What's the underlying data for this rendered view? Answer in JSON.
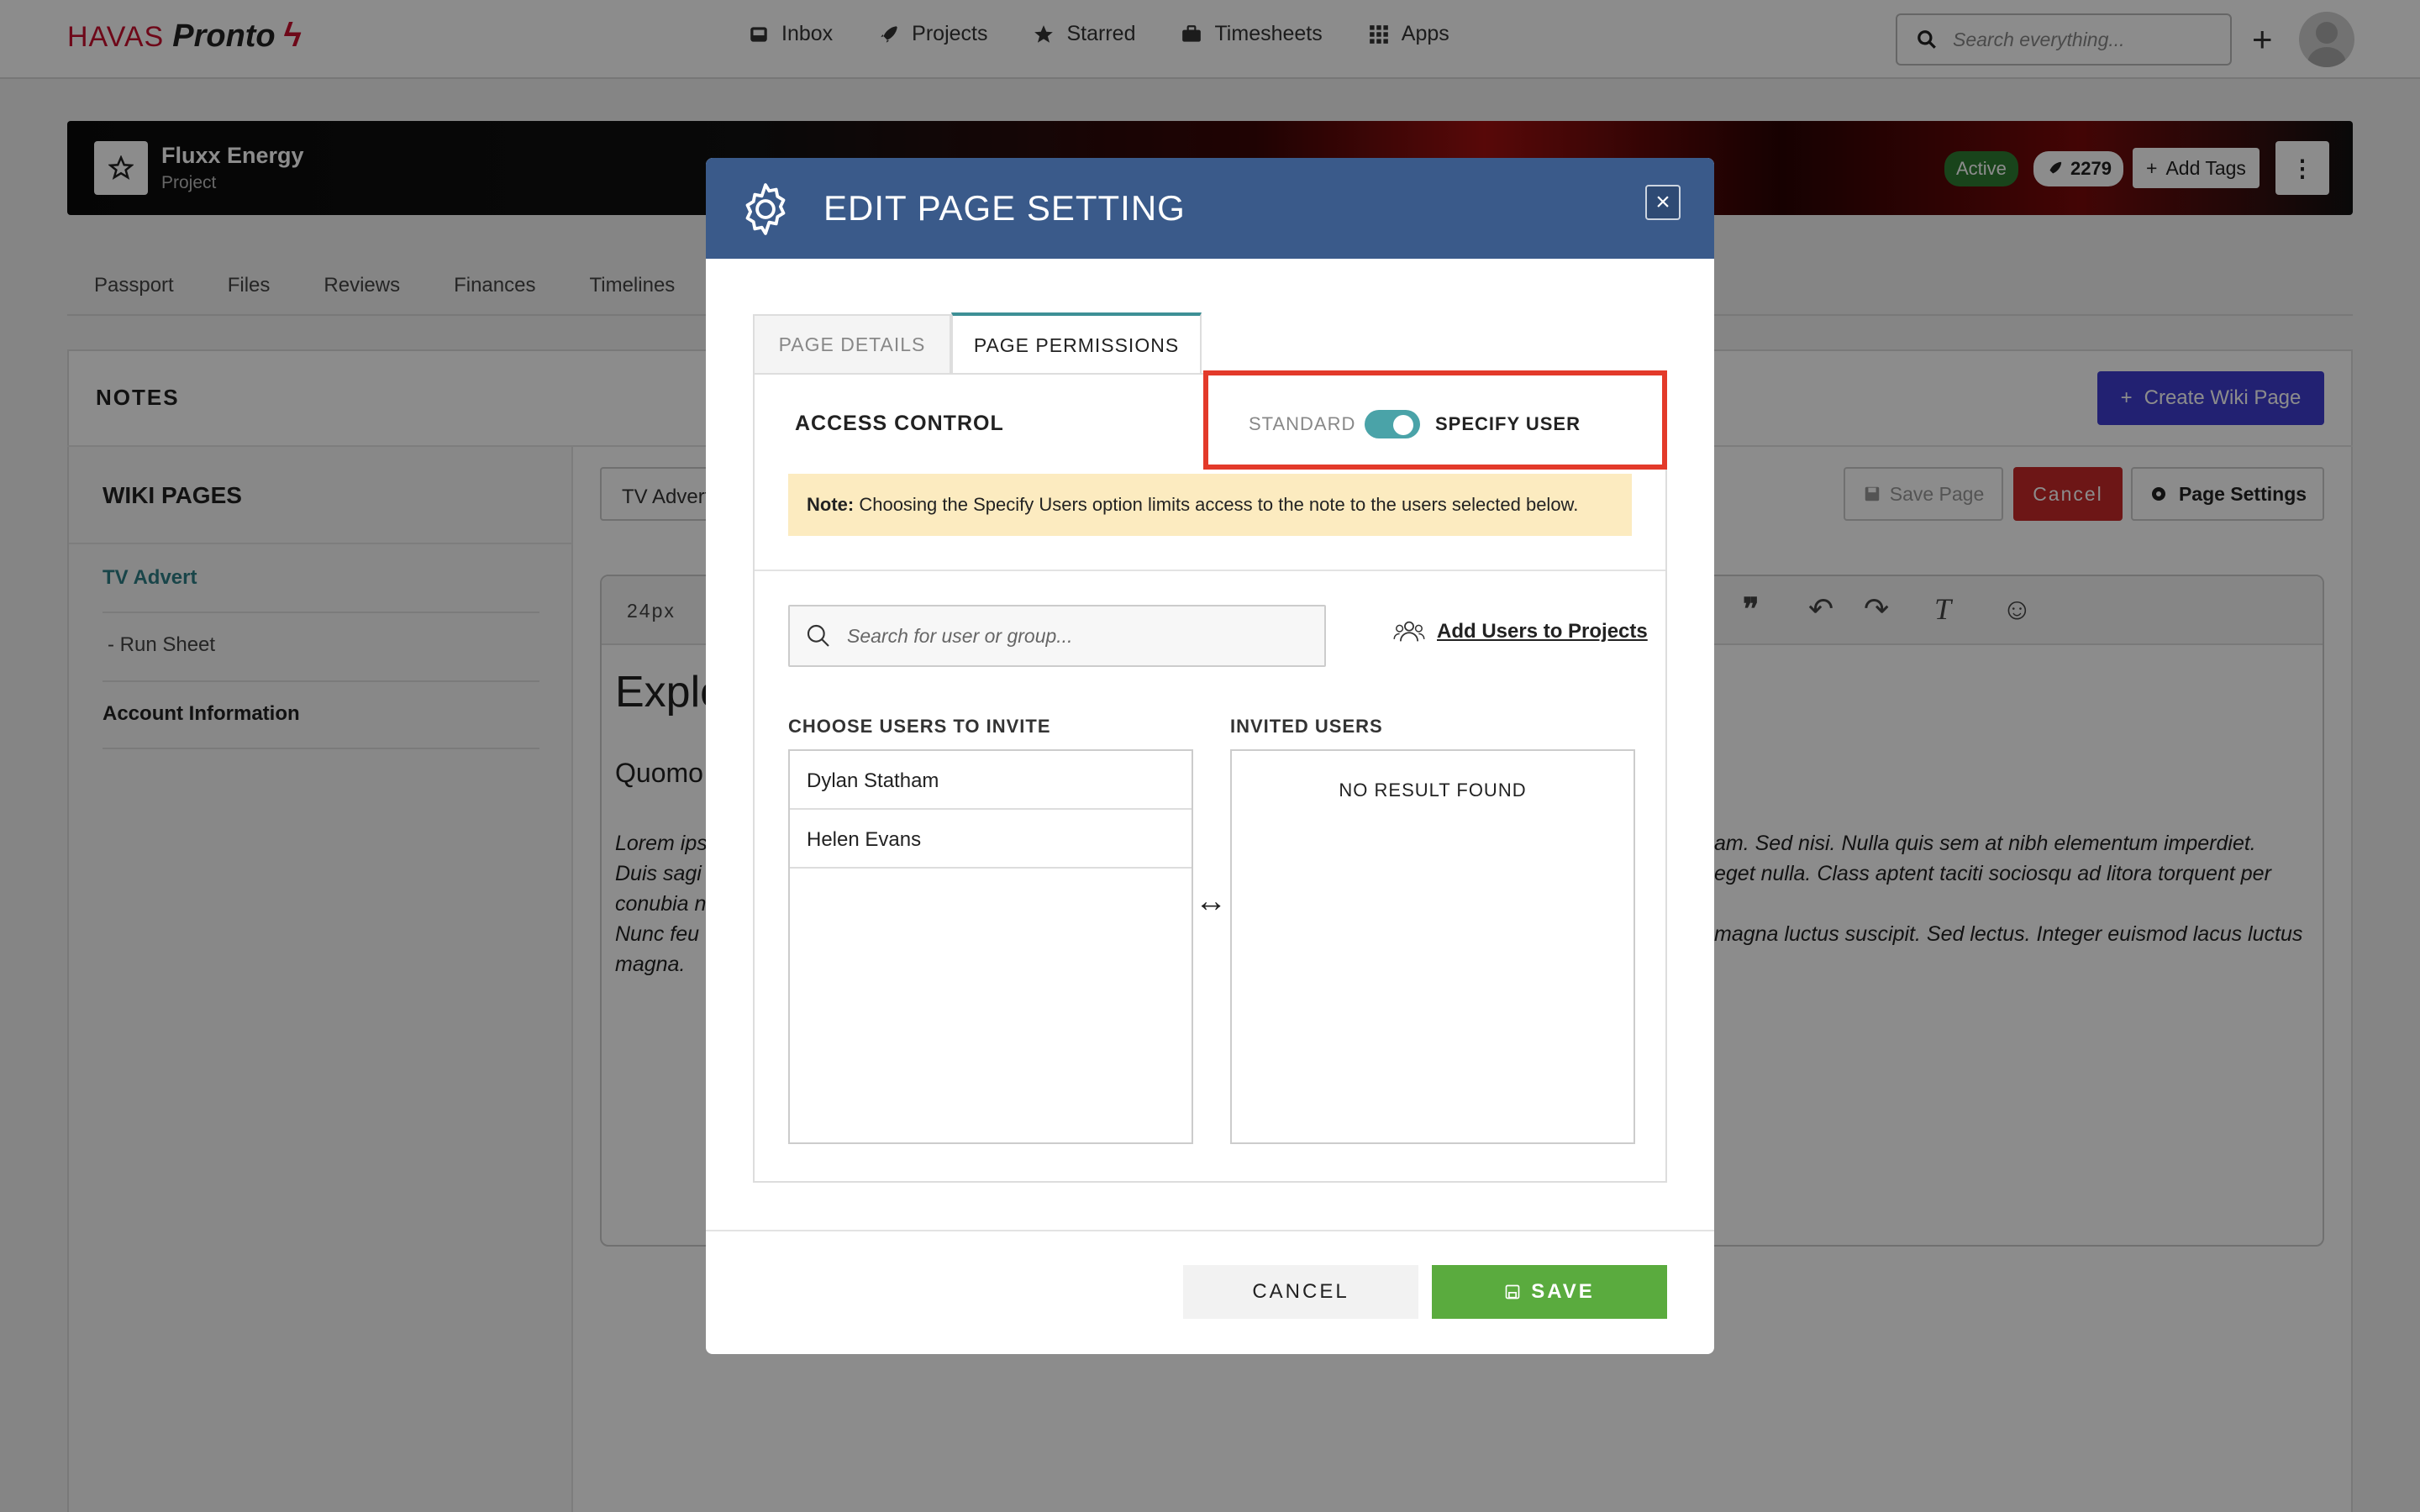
{
  "app": {
    "brand": "HAVAS",
    "product": "Pronto",
    "nav": [
      {
        "label": "Inbox",
        "icon": "inbox-icon"
      },
      {
        "label": "Projects",
        "icon": "rocket-icon"
      },
      {
        "label": "Starred",
        "icon": "star-icon"
      },
      {
        "label": "Timesheets",
        "icon": "briefcase-icon"
      },
      {
        "label": "Apps",
        "icon": "grid-icon"
      }
    ],
    "search_placeholder": "Search everything..."
  },
  "project": {
    "name": "Fluxx Energy",
    "type": "Project",
    "status": "Active",
    "count": "2279",
    "add_tags": "Add Tags",
    "tabs": [
      "Passport",
      "Files",
      "Reviews",
      "Finances",
      "Timelines"
    ]
  },
  "notes": {
    "title": "NOTES",
    "create_wiki": "Create Wiki Page",
    "wiki_title": "WIKI PAGES",
    "wiki_items": [
      "TV Advert",
      "- Run Sheet",
      "Account Information"
    ],
    "page_title_value": "TV Advert",
    "save_page": "Save Page",
    "cancel": "Cancel",
    "page_settings": "Page Settings",
    "font_size": "24px",
    "editor_h1": "Explo",
    "editor_h2": "Quomo",
    "editor_lines_left": [
      "Lorem ips",
      "Duis sagi",
      "conubia n",
      "Nunc feu",
      "magna."
    ],
    "editor_lines_right": [
      "am. Sed nisi. Nulla quis sem at nibh elementum imperdiet.",
      "eget nulla. Class aptent taciti sociosqu ad litora torquent per",
      "",
      "magna luctus suscipit. Sed lectus. Integer euismod lacus luctus",
      ""
    ]
  },
  "modal": {
    "title": "EDIT PAGE SETTING",
    "tabs": [
      "PAGE DETAILS",
      "PAGE PERMISSIONS"
    ],
    "access_control": "ACCESS CONTROL",
    "standard": "STANDARD",
    "specify_user": "SPECIFY USER",
    "toggle_on": true,
    "note_bold": "Note:",
    "note_text": " Choosing the Specify Users option limits access to the note to the users selected below.",
    "search_placeholder": "Search for user or group...",
    "add_users_link": "Add Users to Projects",
    "choose_label": "CHOOSE USERS TO INVITE",
    "invited_label": "INVITED USERS",
    "users": [
      "Dylan Statham",
      "Helen Evans"
    ],
    "no_result": "NO RESULT FOUND",
    "cancel": "CANCEL",
    "save": "SAVE"
  },
  "colors": {
    "header_blue": "#3a5a8a",
    "save_green": "#5aab3e",
    "highlight_red": "#e33a2a",
    "toggle_teal": "#4aa3a8",
    "brand_red": "#c8102e",
    "create_wiki_purple": "#3f3ccf"
  }
}
